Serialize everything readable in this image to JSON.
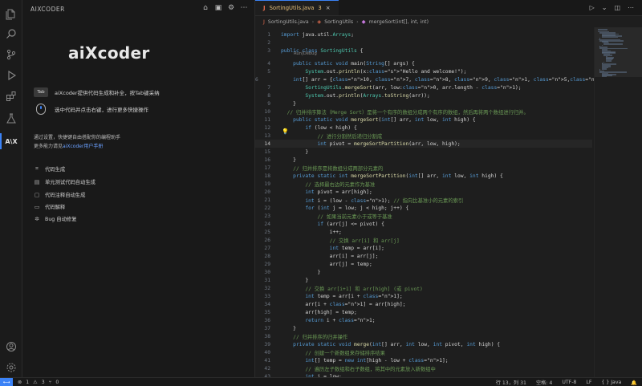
{
  "side_panel": {
    "title": "AIXCODER",
    "logo": "aiXcoder",
    "tips": [
      {
        "key": "Tab",
        "text": "aiXcoder提供代码生成和补全，按Tab键采纳"
      },
      {
        "key": "",
        "text": "选中代码并点击右键，进行更多快捷操作"
      }
    ],
    "intro_line1": "通过设置，快捷键自由搭配你的编程助手",
    "intro_line2_prefix": "更多能力请见",
    "intro_link": "aiXcoder用户手册",
    "features": [
      {
        "icon": "code-icon",
        "label": "代码生成"
      },
      {
        "icon": "test-icon",
        "label": "单元测试代码自动生成"
      },
      {
        "icon": "comment-icon",
        "label": "代码注释自动生成"
      },
      {
        "icon": "explain-icon",
        "label": "代码解释"
      },
      {
        "icon": "bug-icon",
        "label": "Bug 自动修复"
      }
    ]
  },
  "editor": {
    "tab_label": "SortingUtils.java",
    "tab_badge": "3",
    "breadcrumb": [
      "SortingUtils.java",
      "SortingUtils",
      "mergeSort(int[], int, int)"
    ],
    "codelens": "Run|Debug",
    "current_line": 14
  },
  "code_lines": [
    "import java.util.Arrays;",
    "",
    "public class SortingUtils {",
    "    public static void main(String[] args) {",
    "        System.out.println(x:\"Hello and welcome!\");",
    "        int[] arr = {10, 7, 8, 9, 1, 5,8};",
    "        SortingUtils.mergeSort(arr, low:0, arr.length - 1);",
    "        System.out.println(Arrays.toString(arr));",
    "    }",
    "  // 归并排序算法（Merge Sort）是将一个有序的数组分成两个有序的数组，然后再将两个数组进行归并。",
    "    public static void mergeSort(int[] arr, int low, int high) {",
    "        if (low < high) {",
    "            // 进行分割然后递归分割成",
    "            int pivot = mergeSortPartition(arr, low, high);",
    "        }",
    "    }",
    "    // 归并排序是将数组分成两部分元素的",
    "    private static int mergeSortPartition(int[] arr, int low, int high) {",
    "        // 选择最右边的元素作为基准",
    "        int pivot = arr[high];",
    "        int i = (low - 1); // 指向比基准小的元素的索引",
    "        for (int j = low; j < high; j++) {",
    "            // 如果当前元素小于或等于基准",
    "            if (arr[j] <= pivot) {",
    "                i++;",
    "                // 交换 arr[i] 和 arr[j]",
    "                int temp = arr[i];",
    "                arr[i] = arr[j];",
    "                arr[j] = temp;",
    "            }",
    "        }",
    "        // 交换 arr[i+1] 和 arr[high] (或 pivot)",
    "        int temp = arr[i + 1];",
    "        arr[i + 1] = arr[high];",
    "        arr[high] = temp;",
    "        return i + 1;",
    "    }",
    "    // 归并排序的归并操作",
    "    private static void merge(int[] arr, int low, int pivot, int high) {",
    "        // 创建一个新数组来存储排序结果",
    "        int[] temp = new int[high - low + 1];",
    "        // 遍历左子数组和右子数组，将其中的元素放入新数组中",
    "        int i = low;"
  ],
  "status": {
    "errors": "1",
    "warnings": "3",
    "position": "行 13，列 31",
    "spaces": "空格: 4",
    "encoding": "UTF-8",
    "eol": "LF",
    "language": "Java"
  },
  "colors": {
    "accent": "#3b82f6",
    "background": "#1e1e1e",
    "sidebar": "#191919"
  }
}
